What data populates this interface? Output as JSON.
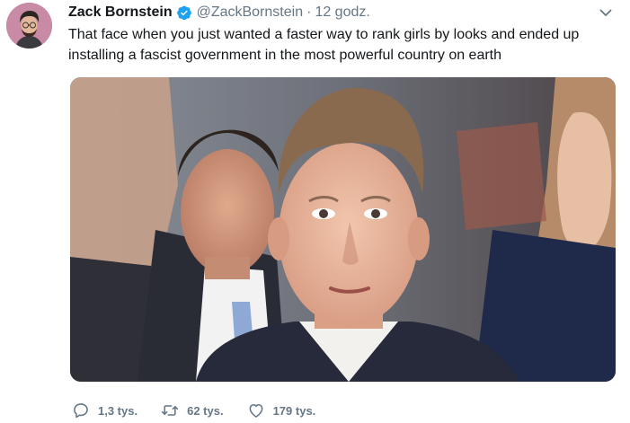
{
  "tweet": {
    "author_name": "Zack Bornstein",
    "handle": "@ZackBornstein",
    "separator": "·",
    "time": "12 godz.",
    "text_lines": [
      "That face when you just wanted a faster way to rank girls by looks and ended up",
      "installing a fascist government in the most powerful country on earth"
    ]
  },
  "actions": {
    "replies": "1,3 tys.",
    "retweets": "62 tys.",
    "likes": "179 tys."
  },
  "icons": {
    "verified": "verified-badge-icon",
    "menu": "chevron-down-icon",
    "reply": "reply-icon",
    "retweet": "retweet-icon",
    "like": "heart-icon"
  },
  "colors": {
    "name": "#14171a",
    "secondary": "#657786",
    "verified": "#1da1f2"
  }
}
